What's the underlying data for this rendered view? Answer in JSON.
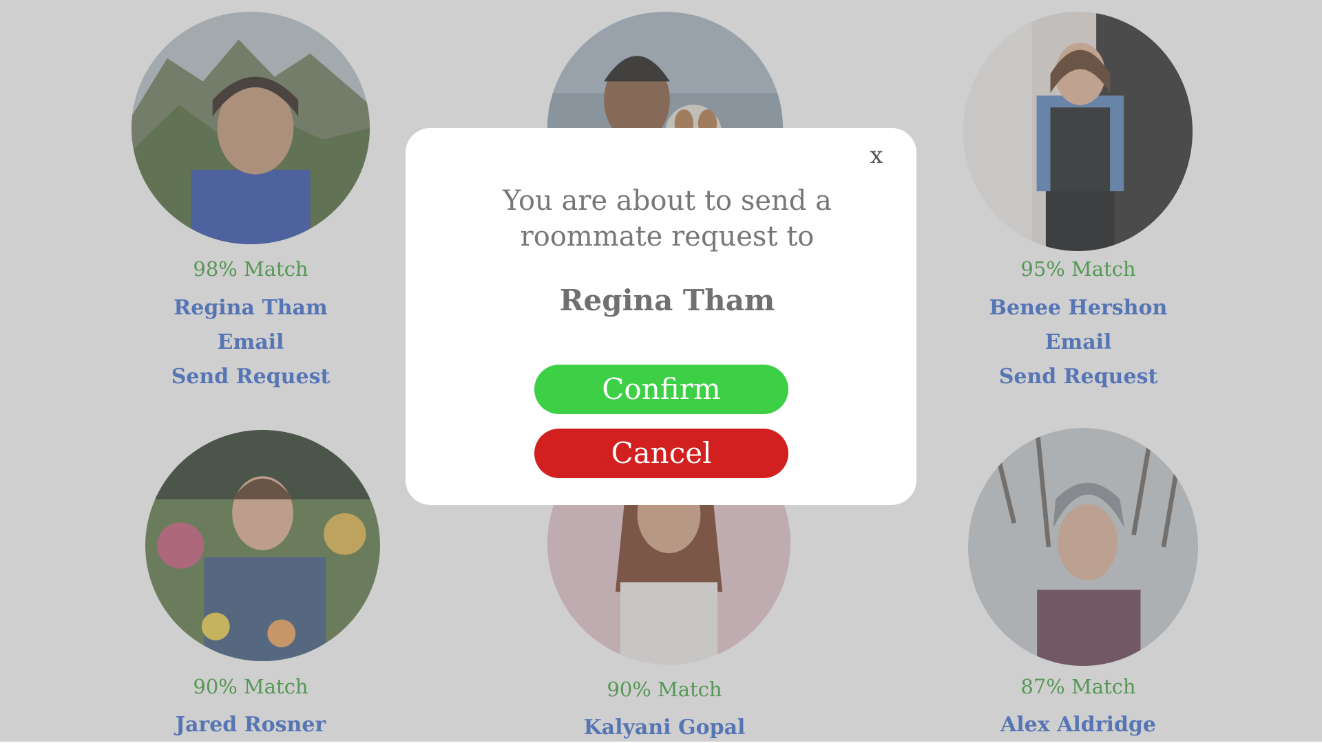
{
  "profiles": [
    {
      "match": "98% Match",
      "name": "Regina Tham",
      "email": "Email",
      "send": "Send Request"
    },
    {
      "match": "",
      "name": "",
      "email": "",
      "send": ""
    },
    {
      "match": "95% Match",
      "name": "Benee Hershon",
      "email": "Email",
      "send": "Send Request"
    },
    {
      "match": "90% Match",
      "name": "Jared Rosner",
      "email": "",
      "send": ""
    },
    {
      "match": "90% Match",
      "name": "Kalyani Gopal",
      "email": "",
      "send": ""
    },
    {
      "match": "87% Match",
      "name": "Alex Aldridge",
      "email": "",
      "send": ""
    }
  ],
  "modal": {
    "close_label": "x",
    "message": "You are about to send a roommate request to",
    "recipient": "Regina Tham",
    "confirm_label": "Confirm",
    "cancel_label": "Cancel"
  },
  "colors": {
    "match_green": "#3aa53a",
    "link_blue": "#3d6fd6",
    "confirm_green": "#3dcf45",
    "cancel_red": "#d21f1f"
  }
}
